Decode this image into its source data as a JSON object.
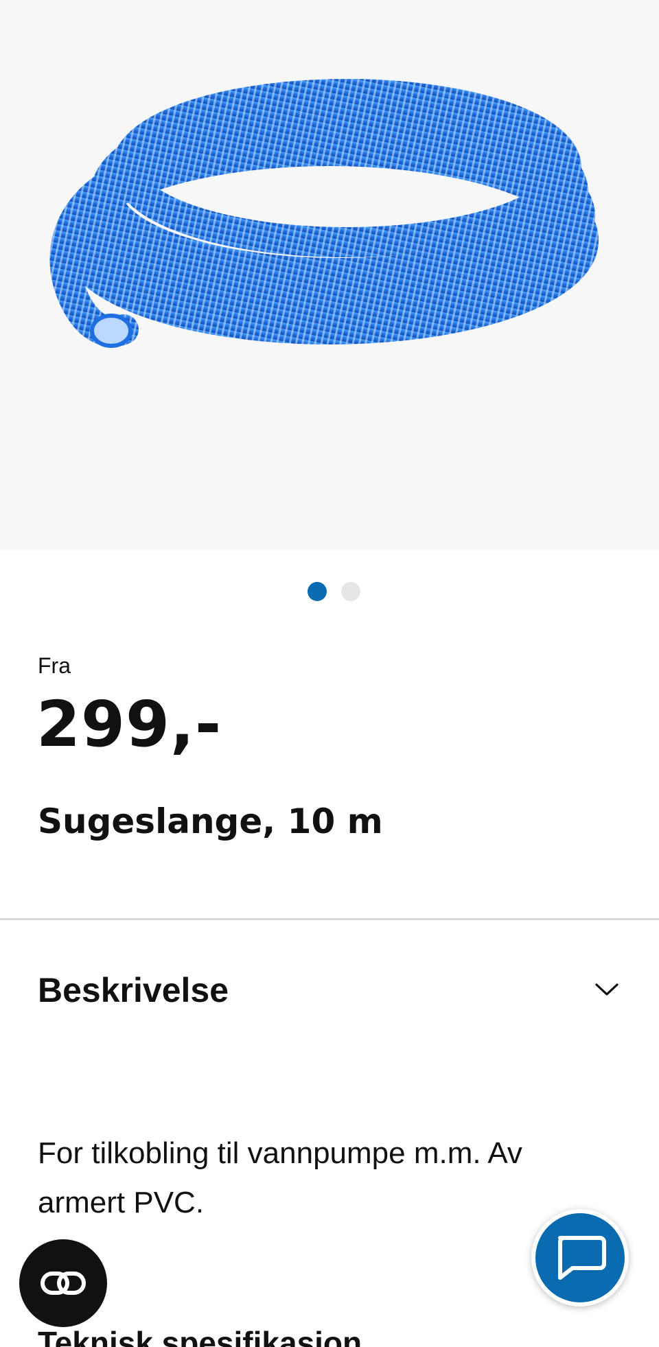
{
  "product": {
    "price_prefix": "Fra",
    "price": "299,-",
    "title": "Sugeslange, 10 m"
  },
  "gallery": {
    "image_icon": "blue-spiral-hose-image",
    "slides_count": 2,
    "active_slide": 1
  },
  "accordion": {
    "description_title": "Beskrivelse",
    "description_text": "For tilkobling til vannpumpe m.m. Av armert PVC.",
    "next_section_title": "Teknisk spesifikasjon"
  },
  "actions": {
    "left_fab_icon": "link-icon",
    "chat_fab_icon": "chat-icon"
  },
  "colors": {
    "accent": "#0a6bb0",
    "text": "#111111",
    "background": "#ffffff",
    "image_bg": "#f7f7f8"
  }
}
